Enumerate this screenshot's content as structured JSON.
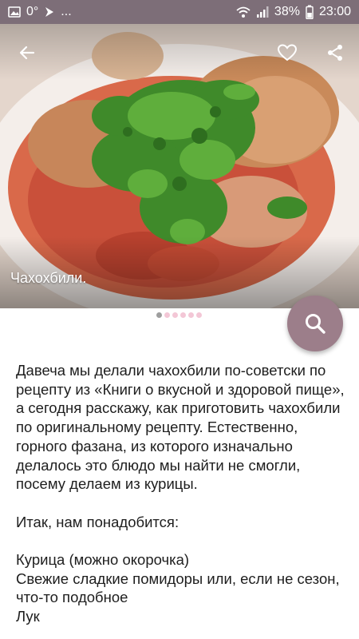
{
  "status_bar": {
    "left_temp": "0°",
    "left_more": "...",
    "battery": "38%",
    "time": "23:00",
    "icons": [
      "image-icon",
      "navigation-icon",
      "wifi-icon",
      "signal-icon",
      "battery-icon"
    ]
  },
  "hero": {
    "caption": "Чахохбили.",
    "pager": {
      "count": 6,
      "active": 0
    },
    "icons": [
      "back-arrow-icon",
      "heart-outline-icon",
      "share-icon"
    ]
  },
  "fab": {
    "icon": "search-icon",
    "color": "#9c7e8a"
  },
  "article": {
    "intro": "Давеча мы делали чахохбили по-советски по рецепту из «Книги о вкусной и здоровой пище», а сегодня расскажу, как приготовить чахохбили по оригинальному рецепту. Естественно, горного фазана, из которого изначально делалось это блюдо мы найти не смогли, посему делаем из курицы.",
    "need": "Итак, нам понадобится:",
    "ingredients": [
      "Курица (можно окорочка)",
      "Свежие сладкие помидоры или, если не сезон, что-то подобное",
      "Лук"
    ]
  },
  "colors": {
    "status_bar": "#7d6e78",
    "fab": "#9c7e8a",
    "dot_inactive": "#f3c7d6",
    "dot_active": "#9e9e9e"
  }
}
